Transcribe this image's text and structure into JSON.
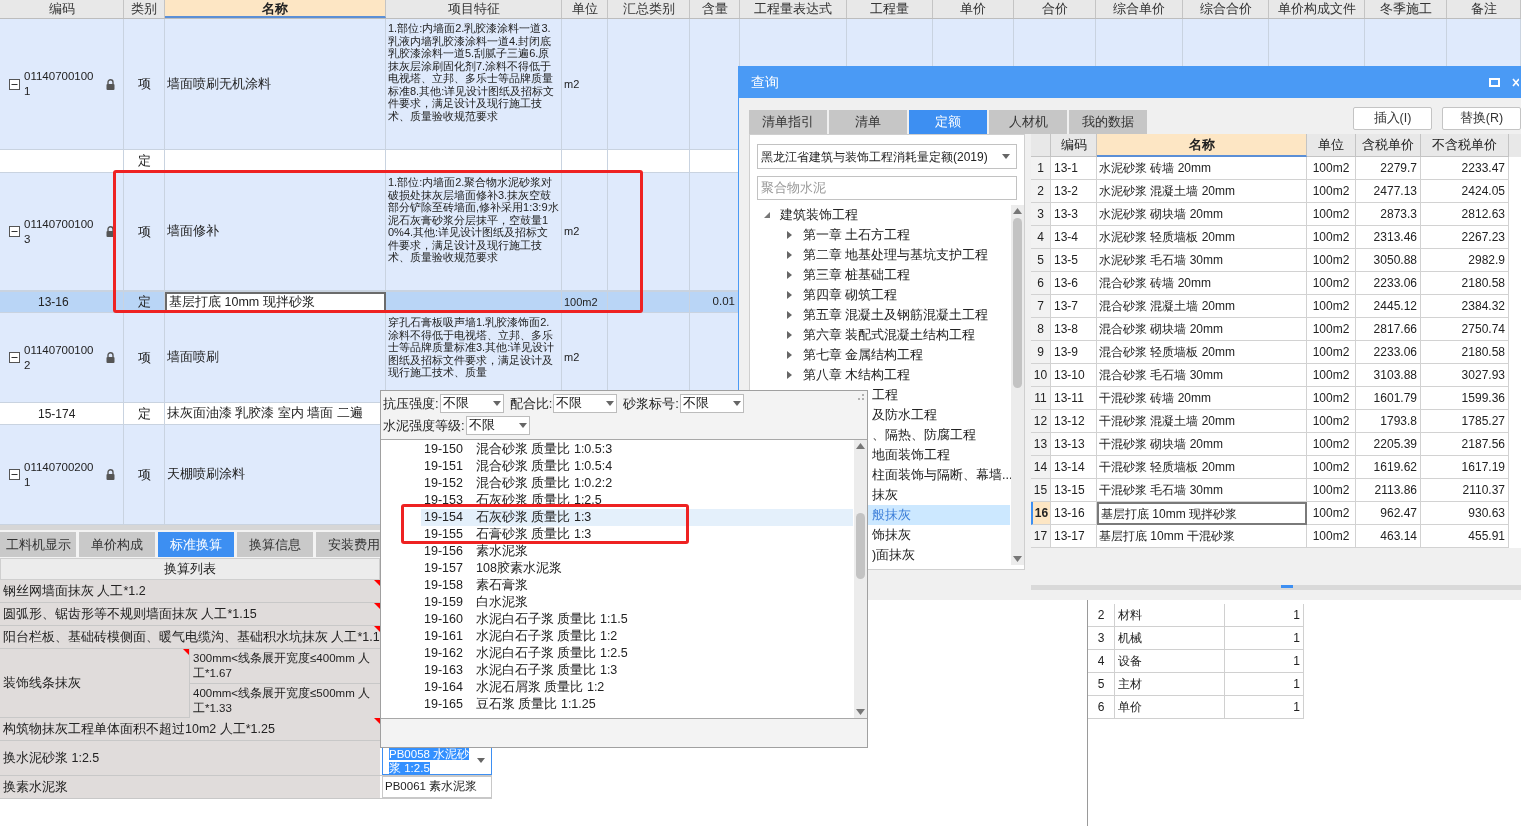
{
  "main_table": {
    "columns": [
      "编码",
      "类别",
      "名称",
      "项目特征",
      "单位",
      "汇总类别",
      "含量",
      "工程量表达式",
      "工程量",
      "单价",
      "合价",
      "综合单价",
      "综合合价",
      "单价构成文件",
      "冬季施工",
      "备注"
    ],
    "rows": [
      {
        "kind": "item",
        "code": "011407001001",
        "type": "项",
        "name": "墙面喷刷无机涂料",
        "features": "1.部位:内墙面2.乳胶漆涂料一道3.乳液内墙乳胶漆涂料一道4.封闭底乳胶漆涂料一道5.刮腻子三遍6.原抹灰层涂刷固化剂7.涂料不得低于电视塔、立邦、多乐士等品牌质量标准8.其他:详见设计图纸及招标文件要求，满足设计及现行施工技术、质量验收规范要求",
        "unit": "m2",
        "locked": true,
        "expanded": true,
        "selected": false
      },
      {
        "kind": "quota",
        "type": "定",
        "selected": false
      },
      {
        "kind": "item",
        "code": "011407001003",
        "type": "项",
        "name": "墙面修补",
        "features": "1.部位:内墙面2.聚合物水泥砂浆对破损处抹灰层墙面修补3.抹灰空鼓部分铲除至砖墙面,修补采用1:3:9水泥石灰膏砂浆分层抹平，空鼓量10%4.其他:详见设计图纸及招标文件要求，满足设计及现行施工技术、质量验收规范要求",
        "unit": "m2",
        "locked": true,
        "expanded": true,
        "selected": false
      },
      {
        "kind": "quota",
        "code": "13-16",
        "type": "定",
        "name": "基层打底 10mm 现拌砂浆",
        "unit": "100m2",
        "amount": "0.01",
        "selected": true
      },
      {
        "kind": "item",
        "code": "011407001002",
        "type": "项",
        "name": "墙面喷刷",
        "features": "穿孔石膏板吸声墙1.乳胶漆饰面2.涂料不得低于电视塔、立邦、多乐士等品牌质量标准3.其他:详见设计图纸及招标文件要求，满足设计及现行施工技术、质量",
        "unit": "m2",
        "locked": true,
        "expanded": true,
        "selected": false
      },
      {
        "kind": "quota",
        "code": "15-174",
        "type": "定",
        "name": "抹灰面油漆 乳胶漆 室内 墙面 二遍",
        "selected": false
      },
      {
        "kind": "item",
        "code": "011407002001",
        "type": "项",
        "name": "天棚喷刷涂料",
        "locked": true,
        "expanded": true,
        "selected": false
      }
    ]
  },
  "conversion_panel": {
    "tabs": [
      {
        "label": "工料机显示",
        "selected": false
      },
      {
        "label": "单价构成",
        "selected": false
      },
      {
        "label": "标准换算",
        "selected": true
      },
      {
        "label": "换算信息",
        "selected": false
      },
      {
        "label": "安装费用",
        "selected": false
      }
    ],
    "header": "换算列表",
    "rows": [
      {
        "kind": "option",
        "label": "钢丝网墙面抹灰 人工*1.2",
        "marked": true
      },
      {
        "kind": "option",
        "label": "圆弧形、锯齿形等不规则墙面抹灰 人工*1.15",
        "marked": true
      },
      {
        "kind": "option",
        "label": "阳台栏板、基础砖模侧面、暖气电缆沟、基础积水坑抹灰 人工*1.1",
        "marked": true
      },
      {
        "kind": "group",
        "label": "装饰线条抹灰",
        "marked": true,
        "options": [
          "300mm<线条展开宽度≤400mm 人工*1.67",
          "400mm<线条展开宽度≤500mm 人工*1.33"
        ]
      },
      {
        "kind": "option",
        "label": "构筑物抹灰工程单体面积不超过10m2 人工*1.25",
        "marked": true
      },
      {
        "kind": "select",
        "label": "换水泥砂浆 1:2.5",
        "value": "PB0058 水泥砂浆 1:2.5",
        "marked": false
      },
      {
        "kind": "replace",
        "label": "换素水泥浆",
        "value": "PB0061 素水泥浆",
        "marked": false
      }
    ]
  },
  "resource_table": {
    "rows": [
      {
        "index": "2",
        "name": "材料",
        "value": "1"
      },
      {
        "index": "3",
        "name": "机械",
        "value": "1"
      },
      {
        "index": "4",
        "name": "设备",
        "value": "1"
      },
      {
        "index": "5",
        "name": "主材",
        "value": "1"
      },
      {
        "index": "6",
        "name": "单价",
        "value": "1"
      }
    ]
  },
  "query_dialog": {
    "title": "查询",
    "tabs": [
      {
        "label": "清单指引",
        "selected": false
      },
      {
        "label": "清单",
        "selected": false
      },
      {
        "label": "定额",
        "selected": true
      },
      {
        "label": "人材机",
        "selected": false
      },
      {
        "label": "我的数据",
        "selected": false
      }
    ],
    "buttons": [
      "插入(I)",
      "替换(R)"
    ],
    "library": "黑龙江省建筑与装饰工程消耗量定额(2019)",
    "search": {
      "placeholder": "聚合物水泥"
    },
    "tree": [
      {
        "label": "建筑装饰工程",
        "expanded": true,
        "selected": false,
        "children": [
          {
            "label": "第一章 土石方工程",
            "expanded": false,
            "selected": false
          },
          {
            "label": "第二章 地基处理与基坑支护工程",
            "expanded": false,
            "selected": false
          },
          {
            "label": "第三章 桩基础工程",
            "expanded": false,
            "selected": false
          },
          {
            "label": "第四章 砌筑工程",
            "expanded": false,
            "selected": false
          },
          {
            "label": "第五章 混凝土及钢筋混凝土工程",
            "expanded": false,
            "selected": false
          },
          {
            "label": "第六章 装配式混凝土结构工程",
            "expanded": false,
            "selected": false
          },
          {
            "label": "第七章 金属结构工程",
            "expanded": false,
            "selected": false
          },
          {
            "label": "第八章 木结构工程",
            "expanded": false,
            "selected": false
          },
          {
            "label": "工程",
            "cut": true,
            "selected": false
          },
          {
            "label": "及防水工程",
            "cut": true,
            "selected": false
          },
          {
            "label": "、隔热、防腐工程",
            "cut": true,
            "selected": false
          },
          {
            "label": "地面装饰工程",
            "cut": true,
            "selected": false
          },
          {
            "label": "柱面装饰与隔断、幕墙...",
            "cut": true,
            "selected": false,
            "children": [
              {
                "label": "抹灰",
                "cut": true,
                "selected": false
              },
              {
                "label": "般抹灰",
                "cut": true,
                "selected": true
              },
              {
                "label": "饰抹灰",
                "cut": true,
                "selected": false
              },
              {
                "label": ")面抹灰",
                "cut": true,
                "selected": false
              }
            ]
          }
        ]
      }
    ],
    "table": {
      "columns": [
        "编码",
        "名称",
        "单位",
        "含税单价",
        "不含税单价"
      ],
      "rows": [
        {
          "index": "1",
          "code": "13-1",
          "name": "水泥砂浆 砖墙 20mm",
          "unit": "100m2",
          "price_tax": "2279.7",
          "price": "2233.47",
          "selected": false
        },
        {
          "index": "2",
          "code": "13-2",
          "name": "水泥砂浆 混凝土墙 20mm",
          "unit": "100m2",
          "price_tax": "2477.13",
          "price": "2424.05",
          "selected": false
        },
        {
          "index": "3",
          "code": "13-3",
          "name": "水泥砂浆 砌块墙 20mm",
          "unit": "100m2",
          "price_tax": "2873.3",
          "price": "2812.63",
          "selected": false
        },
        {
          "index": "4",
          "code": "13-4",
          "name": "水泥砂浆 轻质墙板 20mm",
          "unit": "100m2",
          "price_tax": "2313.46",
          "price": "2267.23",
          "selected": false
        },
        {
          "index": "5",
          "code": "13-5",
          "name": "水泥砂浆 毛石墙 30mm",
          "unit": "100m2",
          "price_tax": "3050.88",
          "price": "2982.9",
          "selected": false
        },
        {
          "index": "6",
          "code": "13-6",
          "name": "混合砂浆 砖墙 20mm",
          "unit": "100m2",
          "price_tax": "2233.06",
          "price": "2180.58",
          "selected": false
        },
        {
          "index": "7",
          "code": "13-7",
          "name": "混合砂浆 混凝土墙 20mm",
          "unit": "100m2",
          "price_tax": "2445.12",
          "price": "2384.32",
          "selected": false
        },
        {
          "index": "8",
          "code": "13-8",
          "name": "混合砂浆 砌块墙 20mm",
          "unit": "100m2",
          "price_tax": "2817.66",
          "price": "2750.74",
          "selected": false
        },
        {
          "index": "9",
          "code": "13-9",
          "name": "混合砂浆 轻质墙板 20mm",
          "unit": "100m2",
          "price_tax": "2233.06",
          "price": "2180.58",
          "selected": false
        },
        {
          "index": "10",
          "code": "13-10",
          "name": "混合砂浆 毛石墙 30mm",
          "unit": "100m2",
          "price_tax": "3103.88",
          "price": "3027.93",
          "selected": false
        },
        {
          "index": "11",
          "code": "13-11",
          "name": "干混砂浆 砖墙 20mm",
          "unit": "100m2",
          "price_tax": "1601.79",
          "price": "1599.36",
          "selected": false
        },
        {
          "index": "12",
          "code": "13-12",
          "name": "干混砂浆 混凝土墙 20mm",
          "unit": "100m2",
          "price_tax": "1793.8",
          "price": "1785.27",
          "selected": false
        },
        {
          "index": "13",
          "code": "13-13",
          "name": "干混砂浆 砌块墙 20mm",
          "unit": "100m2",
          "price_tax": "2205.39",
          "price": "2187.56",
          "selected": false
        },
        {
          "index": "14",
          "code": "13-14",
          "name": "干混砂浆 轻质墙板 20mm",
          "unit": "100m2",
          "price_tax": "1619.62",
          "price": "1617.19",
          "selected": false
        },
        {
          "index": "15",
          "code": "13-15",
          "name": "干混砂浆 毛石墙 30mm",
          "unit": "100m2",
          "price_tax": "2113.86",
          "price": "2110.37",
          "selected": false
        },
        {
          "index": "16",
          "code": "13-16",
          "name": "基层打底 10mm 现拌砂浆",
          "unit": "100m2",
          "price_tax": "962.47",
          "price": "930.63",
          "selected": true
        },
        {
          "index": "17",
          "code": "13-17",
          "name": "基层打底 10mm 干混砂浆",
          "unit": "100m2",
          "price_tax": "463.14",
          "price": "455.91",
          "selected": false
        }
      ]
    }
  },
  "filter_popup": {
    "filters": [
      {
        "label": "抗压强度:",
        "value": "不限"
      },
      {
        "label": "配合比:",
        "value": "不限"
      },
      {
        "label": "砂浆标号:",
        "value": "不限"
      },
      {
        "label": "水泥强度等级:",
        "value": "不限"
      }
    ],
    "items": [
      {
        "code": "19-150",
        "name": "混合砂浆 质量比 1:0.5:3",
        "selected": false
      },
      {
        "code": "19-151",
        "name": "混合砂浆 质量比 1:0.5:4",
        "selected": false
      },
      {
        "code": "19-152",
        "name": "混合砂浆 质量比 1:0.2:2",
        "selected": false
      },
      {
        "code": "19-153",
        "name": "石灰砂浆 质量比 1:2.5",
        "selected": false
      },
      {
        "code": "19-154",
        "name": "石灰砂浆 质量比 1:3",
        "selected": true
      },
      {
        "code": "19-155",
        "name": "石膏砂浆 质量比 1:3",
        "selected": false
      },
      {
        "code": "19-156",
        "name": "素水泥浆",
        "selected": false
      },
      {
        "code": "19-157",
        "name": "108胶素水泥浆",
        "selected": false
      },
      {
        "code": "19-158",
        "name": "素石膏浆",
        "selected": false
      },
      {
        "code": "19-159",
        "name": "白水泥浆",
        "selected": false
      },
      {
        "code": "19-160",
        "name": "水泥白石子浆 质量比 1:1.5",
        "selected": false
      },
      {
        "code": "19-161",
        "name": "水泥白石子浆 质量比 1:2",
        "selected": false
      },
      {
        "code": "19-162",
        "name": "水泥白石子浆 质量比 1:2.5",
        "selected": false
      },
      {
        "code": "19-163",
        "name": "水泥白石子浆 质量比 1:3",
        "selected": false
      },
      {
        "code": "19-164",
        "name": "水泥石屑浆 质量比 1:2",
        "selected": false
      },
      {
        "code": "19-165",
        "name": "豆石浆 质量比 1:1.25",
        "selected": false
      }
    ]
  }
}
